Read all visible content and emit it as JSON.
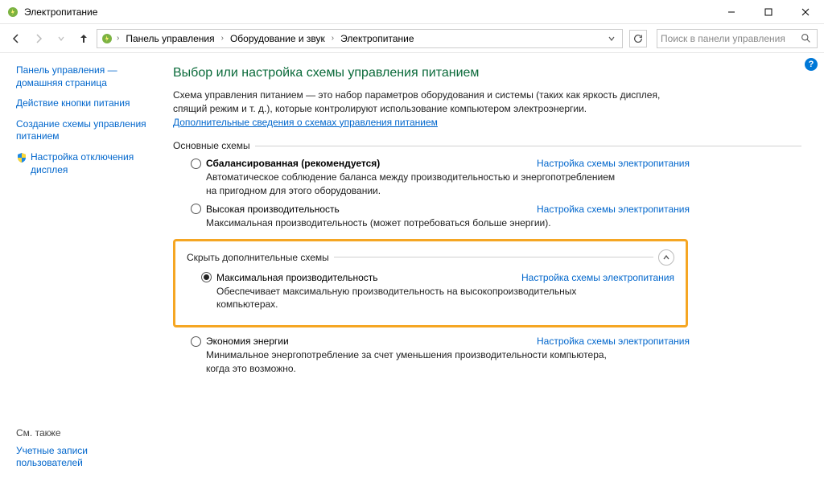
{
  "window": {
    "title": "Электропитание"
  },
  "breadcrumb": {
    "items": [
      "Панель управления",
      "Оборудование и звук",
      "Электропитание"
    ]
  },
  "search": {
    "placeholder": "Поиск в панели управления"
  },
  "sidebar": {
    "home": "Панель управления — домашняя страница",
    "links": [
      "Действие кнопки питания",
      "Создание схемы управления питанием",
      "Настройка отключения дисплея"
    ],
    "see_also_label": "См. также",
    "see_also_link": "Учетные записи пользователей"
  },
  "main": {
    "title": "Выбор или настройка схемы управления питанием",
    "desc_line1": "Схема управления питанием — это набор параметров оборудования и системы (таких как яркость дисплея, спящий режим и т. д.), которые контролируют использование компьютером электроэнергии.",
    "desc_link": "Дополнительные сведения о схемах управления питанием",
    "group_basic": "Основные схемы",
    "group_additional": "Скрыть дополнительные схемы",
    "plan_link": "Настройка схемы электропитания",
    "plans_basic": [
      {
        "name": "Сбалансированная (рекомендуется)",
        "desc": "Автоматическое соблюдение баланса между производительностью и энергопотреблением на пригодном для этого оборудовании.",
        "bold": true
      },
      {
        "name": "Высокая производительность",
        "desc": "Максимальная производительность (может потребоваться больше энергии).",
        "bold": false
      }
    ],
    "plan_additional": {
      "name": "Максимальная производительность",
      "desc": "Обеспечивает максимальную производительность на высокопроизводительных компьютерах."
    },
    "plan_saver": {
      "name": "Экономия энергии",
      "desc": "Минимальное энергопотребление за счет уменьшения производительности компьютера, когда это возможно."
    }
  }
}
